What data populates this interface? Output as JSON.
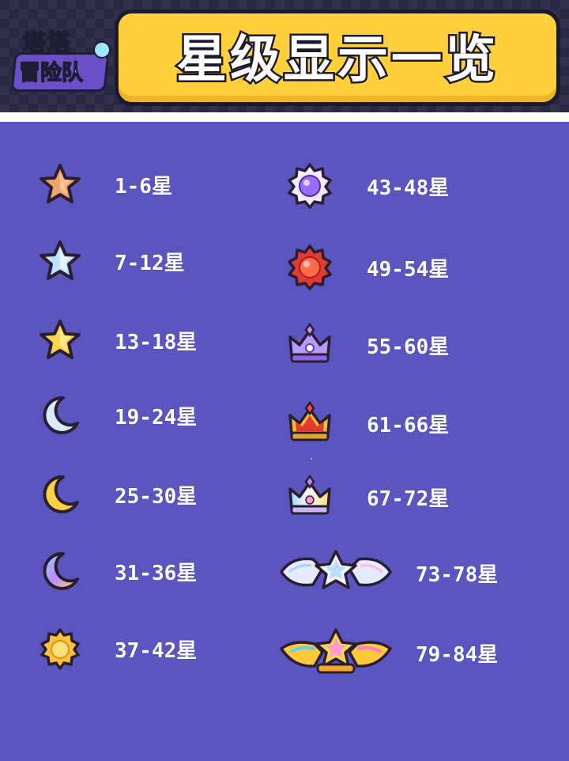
{
  "logo": {
    "line1": "塔塔",
    "line2": "冒险队"
  },
  "title": "星级显示一览",
  "left_column": [
    {
      "label": "1-6星",
      "icon": "bronze-star-icon",
      "color": "#f0a46c"
    },
    {
      "label": "7-12星",
      "icon": "silver-blue-star-icon",
      "color": "#bfe2ff"
    },
    {
      "label": "13-18星",
      "icon": "gold-star-icon",
      "color": "#ffd44a"
    },
    {
      "label": "19-24星",
      "icon": "silver-moon-icon",
      "color": "#d8eaff"
    },
    {
      "label": "25-30星",
      "icon": "gold-moon-icon",
      "color": "#ffd140"
    },
    {
      "label": "31-36星",
      "icon": "rainbow-moon-icon",
      "color": "#b98cff"
    },
    {
      "label": "37-42星",
      "icon": "gold-sun-icon",
      "color": "#ffc23a"
    }
  ],
  "right_column": [
    {
      "label": "43-48星",
      "icon": "purple-orb-badge-icon",
      "color": "#9a6bff"
    },
    {
      "label": "49-54星",
      "icon": "red-orb-badge-icon",
      "color": "#ff4a3d"
    },
    {
      "label": "55-60星",
      "icon": "purple-crown-icon",
      "color": "#a07bff"
    },
    {
      "label": "61-66星",
      "icon": "red-gold-crown-icon",
      "color": "#ff5a3a"
    },
    {
      "label": "67-72星",
      "icon": "rainbow-crown-icon",
      "color": "#c9b8ff"
    },
    {
      "label": "73-78星",
      "icon": "silver-winged-emblem-icon",
      "color": "#e6eaff"
    },
    {
      "label": "79-84星",
      "icon": "gold-winged-emblem-icon",
      "color": "#ffc93a"
    }
  ]
}
